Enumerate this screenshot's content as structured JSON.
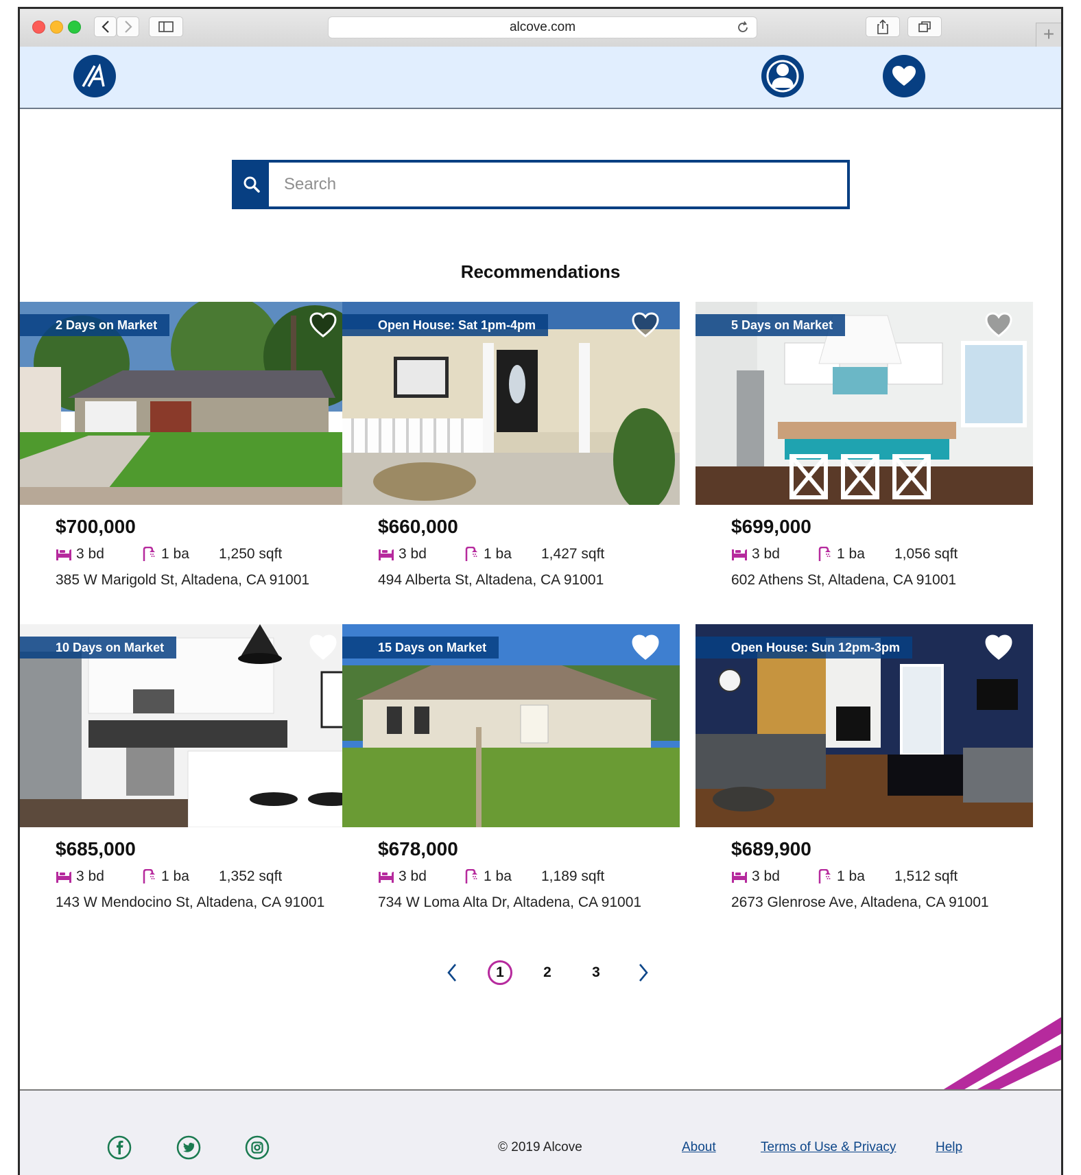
{
  "browser": {
    "url": "alcove.com"
  },
  "header": {
    "logo_icon": "alcove-logo-icon",
    "account_icon": "user-icon",
    "favorites_icon": "heart-icon"
  },
  "search": {
    "placeholder": "Search",
    "icon": "search-icon"
  },
  "section_title": "Recommendations",
  "listings": [
    {
      "tag": "2 Days on Market",
      "price": "$700,000",
      "beds": "3 bd",
      "baths": "1 ba",
      "sqft": "1,250 sqft",
      "address": "385 W Marigold St, Altadena, CA 91001"
    },
    {
      "tag": "Open House: Sat 1pm-4pm",
      "price": "$660,000",
      "beds": "3 bd",
      "baths": "1 ba",
      "sqft": "1,427 sqft",
      "address": "494 Alberta St, Altadena, CA 91001"
    },
    {
      "tag": "5 Days on Market",
      "price": "$699,000",
      "beds": "3 bd",
      "baths": "1 ba",
      "sqft": "1,056 sqft",
      "address": "602 Athens St, Altadena, CA 91001"
    },
    {
      "tag": "10 Days on Market",
      "price": "$685,000",
      "beds": "3 bd",
      "baths": "1 ba",
      "sqft": "1,352 sqft",
      "address": "143 W Mendocino St, Altadena, CA 91001"
    },
    {
      "tag": "15 Days on Market",
      "price": "$678,000",
      "beds": "3 bd",
      "baths": "1 ba",
      "sqft": "1,189 sqft",
      "address": "734 W Loma Alta Dr, Altadena, CA 91001"
    },
    {
      "tag": "Open House: Sun 12pm-3pm",
      "price": "$689,900",
      "beds": "3 bd",
      "baths": "1 ba",
      "sqft": "1,512 sqft",
      "address": "2673 Glenrose Ave, Altadena, CA 91001"
    }
  ],
  "pagination": {
    "pages": [
      "1",
      "2",
      "3"
    ],
    "current": "1"
  },
  "footer": {
    "social": [
      "facebook-icon",
      "twitter-icon",
      "instagram-icon"
    ],
    "copyright": "© 2019 Alcove",
    "links": [
      "About",
      "Terms of Use & Privacy",
      "Help"
    ]
  },
  "colors": {
    "brand_blue": "#073f82",
    "accent_magenta": "#b62a9d",
    "header_bg": "#e1eefe",
    "footer_bg": "#efeff4",
    "social_green": "#1a7a50"
  }
}
